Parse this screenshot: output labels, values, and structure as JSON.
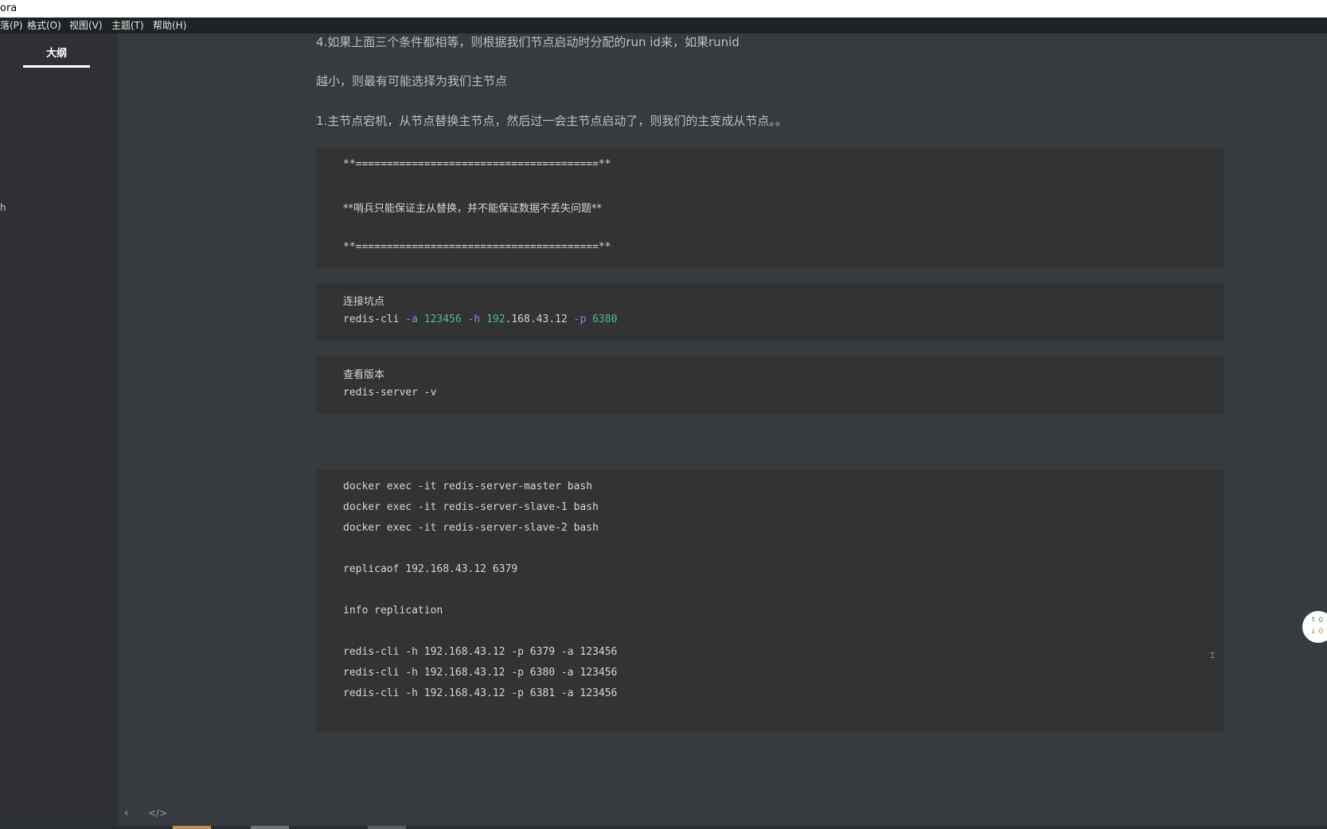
{
  "window": {
    "title_fragment": "ora"
  },
  "menu": [
    {
      "label": "落(P)"
    },
    {
      "label": "格式(O)"
    },
    {
      "label": "视图(V)"
    },
    {
      "label": "主题(T)"
    },
    {
      "label": "帮助(H)"
    }
  ],
  "sidebar": {
    "tab_label": "大纲",
    "fragment": "h"
  },
  "paragraphs": [
    "4.如果上面三个条件都相等，则根据我们节点启动时分配的run id来，如果runid",
    "越小，则最有可能选择为我们主节点",
    "1.主节点宕机，从节点替换主节点，然后过一会主节点启动了，则我们的主变成从节点。。"
  ],
  "code_blocks": [
    {
      "lines": [
        "**=======================================**",
        "",
        "**哨兵只能保证主从替换，并不能保证数据不丢失问题**",
        "",
        "**=======================================**"
      ]
    },
    {
      "lines": [
        "连接坑点"
      ],
      "command": {
        "cmd": "redis-cli ",
        "flag_a": "-a",
        "val_a": " 123456 ",
        "flag_h": "-h",
        "host_part1": " 192",
        "host_part2": ".168.43.12 ",
        "flag_p": "-p",
        "val_p": " 6380"
      }
    },
    {
      "lines": [
        "查看版本",
        "redis-server -v"
      ]
    },
    {
      "lines": [
        "docker exec -it redis-server-master bash",
        "docker exec -it redis-server-slave-1 bash",
        "docker exec -it redis-server-slave-2 bash",
        "",
        "replicaof 192.168.43.12 6379",
        "",
        "info replication",
        "",
        "redis-cli -h 192.168.43.12 -p 6379 -a 123456",
        "redis-cli -h 192.168.43.12 -p 6380 -a 123456",
        "redis-cli -h 192.168.43.12 -p 6381 -a 123456"
      ]
    }
  ],
  "word_count": {
    "up": "↑ 0",
    "down": "↓ 0"
  },
  "bottom_bar": {
    "back_icon": "‹",
    "source_icon": "</>"
  },
  "colors": {
    "background": "#363b40",
    "sidebar": "#2e3033",
    "code_background": "#333333",
    "code_flag": "#7d8ce0",
    "code_number": "#4fb8a0",
    "accent_strip": [
      "#c98a45",
      "#6e7378",
      "#5a5f64"
    ]
  }
}
